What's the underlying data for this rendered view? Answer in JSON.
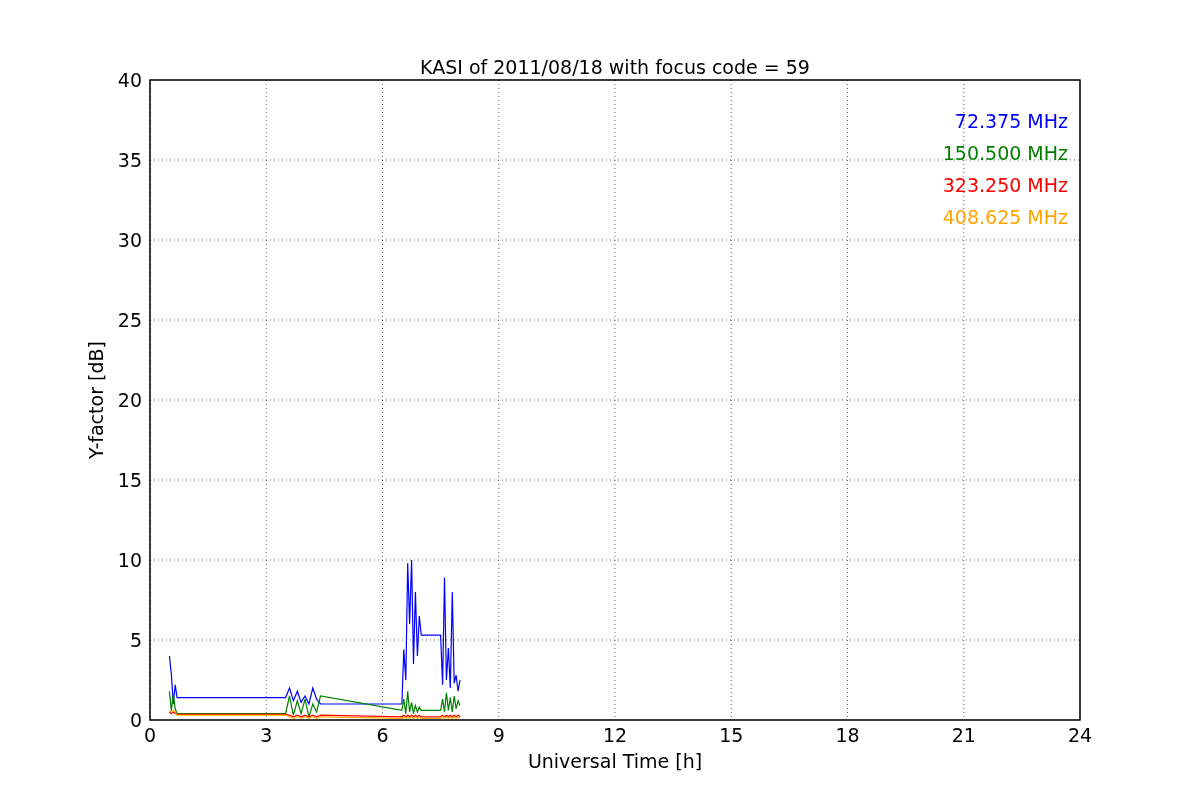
{
  "chart_data": {
    "type": "line",
    "title": "KASI of 2011/08/18 with focus code = 59",
    "xlabel": "Universal Time [h]",
    "ylabel": "Y-factor [dB]",
    "x": [
      0.5,
      0.55,
      0.6,
      0.65,
      0.7,
      3.5,
      3.6,
      3.7,
      3.8,
      3.9,
      4.0,
      4.1,
      4.2,
      4.3,
      4.4,
      6.5,
      6.55,
      6.6,
      6.65,
      6.7,
      6.75,
      6.8,
      6.85,
      6.9,
      6.95,
      7.0,
      7.5,
      7.55,
      7.6,
      7.65,
      7.7,
      7.75,
      7.8,
      7.85,
      7.9,
      7.95,
      8.0
    ],
    "series": [
      {
        "name": "72.375 MHz",
        "color": "#0000ff",
        "values": [
          4.0,
          2.9,
          1.0,
          2.2,
          1.4,
          1.4,
          2.0,
          1.2,
          1.8,
          1.1,
          1.5,
          1.0,
          2.0,
          1.3,
          1.0,
          1.0,
          4.4,
          2.5,
          9.8,
          6.0,
          10.0,
          3.5,
          8.0,
          4.0,
          6.5,
          5.3,
          5.3,
          2.2,
          8.9,
          2.5,
          4.5,
          2.0,
          8.0,
          2.3,
          2.8,
          1.8,
          2.5
        ]
      },
      {
        "name": "150.500 MHz",
        "color": "#008000",
        "values": [
          1.8,
          0.6,
          1.6,
          0.7,
          0.4,
          0.4,
          1.5,
          0.3,
          1.2,
          0.4,
          1.3,
          0.2,
          1.0,
          0.5,
          1.5,
          0.6,
          1.3,
          0.4,
          1.8,
          0.5,
          1.1,
          0.4,
          0.9,
          0.5,
          0.8,
          0.6,
          0.6,
          1.3,
          0.5,
          1.7,
          0.6,
          1.4,
          0.5,
          1.5,
          0.7,
          1.2,
          0.9
        ]
      },
      {
        "name": "323.250 MHz",
        "color": "#ff0000",
        "values": [
          0.5,
          0.4,
          0.5,
          0.4,
          0.35,
          0.35,
          0.3,
          0.2,
          0.3,
          0.2,
          0.3,
          0.2,
          0.3,
          0.2,
          0.3,
          0.2,
          0.3,
          0.2,
          0.3,
          0.2,
          0.3,
          0.2,
          0.3,
          0.2,
          0.3,
          0.2,
          0.2,
          0.3,
          0.2,
          0.3,
          0.2,
          0.3,
          0.2,
          0.3,
          0.2,
          0.3,
          0.2
        ]
      },
      {
        "name": "408.625 MHz",
        "color": "#ffa500",
        "values": [
          0.6,
          0.5,
          0.6,
          0.5,
          0.3,
          0.3,
          0.2,
          0.1,
          0.2,
          0.1,
          0.2,
          0.1,
          0.2,
          0.1,
          0.2,
          0.1,
          0.2,
          0.1,
          0.2,
          0.1,
          0.2,
          0.1,
          0.2,
          0.1,
          0.2,
          0.1,
          0.1,
          0.2,
          0.1,
          0.2,
          0.1,
          0.2,
          0.1,
          0.2,
          0.1,
          0.2,
          0.1
        ]
      }
    ],
    "xlim": [
      0,
      24
    ],
    "ylim": [
      0,
      40
    ],
    "xticks": [
      0,
      3,
      6,
      9,
      12,
      15,
      18,
      21,
      24
    ],
    "yticks": [
      0,
      5,
      10,
      15,
      20,
      25,
      30,
      35,
      40
    ],
    "grid": true
  }
}
